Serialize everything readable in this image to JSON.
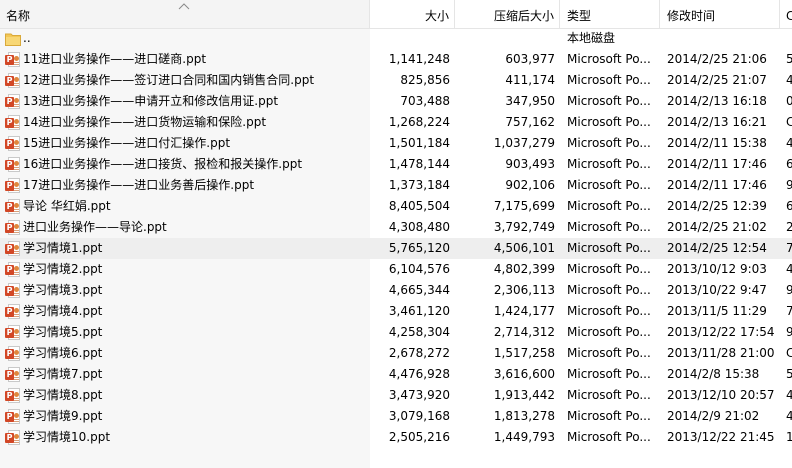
{
  "columns": {
    "name": "名称",
    "size": "大小",
    "compressed": "压缩后大小",
    "type": "类型",
    "modified": "修改时间",
    "extra": "C"
  },
  "colors": {
    "ppt_badge": "#d24726",
    "folder": "#f3c756",
    "highlight_row": "#eeeeee"
  },
  "parent": {
    "name": "..",
    "type": "本地磁盘",
    "icon": "folder-icon"
  },
  "files": [
    {
      "name": "11进口业务操作——进口磋商.ppt",
      "size": "1,141,248",
      "compressed": "603,977",
      "type": "Microsoft Po...",
      "modified": "2014/2/25 21:06",
      "extra": "5",
      "icon": "ppt-icon"
    },
    {
      "name": "12进口业务操作——签订进口合同和国内销售合同.ppt",
      "size": "825,856",
      "compressed": "411,174",
      "type": "Microsoft Po...",
      "modified": "2014/2/25 21:07",
      "extra": "4",
      "icon": "ppt-icon"
    },
    {
      "name": "13进口业务操作——申请开立和修改信用证.ppt",
      "size": "703,488",
      "compressed": "347,950",
      "type": "Microsoft Po...",
      "modified": "2014/2/13 16:18",
      "extra": "0",
      "icon": "ppt-icon"
    },
    {
      "name": "14进口业务操作——进口货物运输和保险.ppt",
      "size": "1,268,224",
      "compressed": "757,162",
      "type": "Microsoft Po...",
      "modified": "2014/2/13 16:21",
      "extra": "C",
      "icon": "ppt-icon"
    },
    {
      "name": "15进口业务操作——进口付汇操作.ppt",
      "size": "1,501,184",
      "compressed": "1,037,279",
      "type": "Microsoft Po...",
      "modified": "2014/2/11 15:38",
      "extra": "4",
      "icon": "ppt-icon"
    },
    {
      "name": "16进口业务操作——进口接货、报检和报关操作.ppt",
      "size": "1,478,144",
      "compressed": "903,493",
      "type": "Microsoft Po...",
      "modified": "2014/2/11 17:46",
      "extra": "6",
      "icon": "ppt-icon"
    },
    {
      "name": "17进口业务操作——进口业务善后操作.ppt",
      "size": "1,373,184",
      "compressed": "902,106",
      "type": "Microsoft Po...",
      "modified": "2014/2/11 17:46",
      "extra": "9",
      "icon": "ppt-icon"
    },
    {
      "name": "导论 华红娟.ppt",
      "size": "8,405,504",
      "compressed": "7,175,699",
      "type": "Microsoft Po...",
      "modified": "2014/2/25 12:39",
      "extra": "6",
      "icon": "ppt-icon"
    },
    {
      "name": "进口业务操作——导论.ppt",
      "size": "4,308,480",
      "compressed": "3,792,749",
      "type": "Microsoft Po...",
      "modified": "2014/2/25 21:02",
      "extra": "2",
      "icon": "ppt-icon"
    },
    {
      "name": "学习情境1.ppt",
      "size": "5,765,120",
      "compressed": "4,506,101",
      "type": "Microsoft Po...",
      "modified": "2014/2/25 12:54",
      "extra": "7",
      "icon": "ppt-icon",
      "highlighted": true
    },
    {
      "name": "学习情境2.ppt",
      "size": "6,104,576",
      "compressed": "4,802,399",
      "type": "Microsoft Po...",
      "modified": "2013/10/12 9:03",
      "extra": "4",
      "icon": "ppt-icon"
    },
    {
      "name": "学习情境3.ppt",
      "size": "4,665,344",
      "compressed": "2,306,113",
      "type": "Microsoft Po...",
      "modified": "2013/10/22 9:47",
      "extra": "9",
      "icon": "ppt-icon"
    },
    {
      "name": "学习情境4.ppt",
      "size": "3,461,120",
      "compressed": "1,424,177",
      "type": "Microsoft Po...",
      "modified": "2013/11/5 11:29",
      "extra": "7",
      "icon": "ppt-icon"
    },
    {
      "name": "学习情境5.ppt",
      "size": "4,258,304",
      "compressed": "2,714,312",
      "type": "Microsoft Po...",
      "modified": "2013/12/22 17:54",
      "extra": "9",
      "icon": "ppt-icon"
    },
    {
      "name": "学习情境6.ppt",
      "size": "2,678,272",
      "compressed": "1,517,258",
      "type": "Microsoft Po...",
      "modified": "2013/11/28 21:00",
      "extra": "C",
      "icon": "ppt-icon"
    },
    {
      "name": "学习情境7.ppt",
      "size": "4,476,928",
      "compressed": "3,616,600",
      "type": "Microsoft Po...",
      "modified": "2014/2/8 15:38",
      "extra": "5",
      "icon": "ppt-icon"
    },
    {
      "name": "学习情境8.ppt",
      "size": "3,473,920",
      "compressed": "1,913,442",
      "type": "Microsoft Po...",
      "modified": "2013/12/10 20:57",
      "extra": "4",
      "icon": "ppt-icon"
    },
    {
      "name": "学习情境9.ppt",
      "size": "3,079,168",
      "compressed": "1,813,278",
      "type": "Microsoft Po...",
      "modified": "2014/2/9 21:02",
      "extra": "4",
      "icon": "ppt-icon"
    },
    {
      "name": "学习情境10.ppt",
      "size": "2,505,216",
      "compressed": "1,449,793",
      "type": "Microsoft Po...",
      "modified": "2013/12/22 21:45",
      "extra": "1",
      "icon": "ppt-icon"
    }
  ]
}
